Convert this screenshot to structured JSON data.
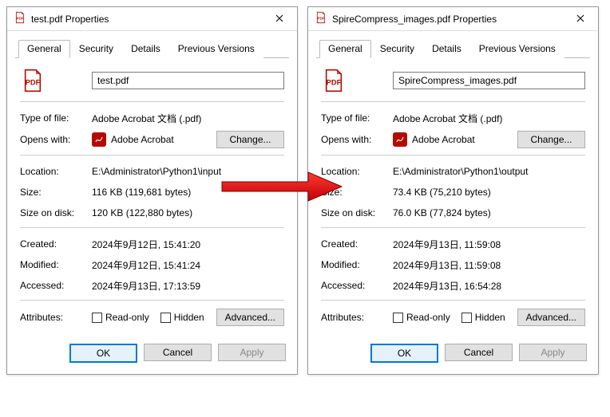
{
  "dialogs": [
    {
      "title": "test.pdf Properties",
      "filename": "test.pdf",
      "type_of_file": "Adobe Acrobat 文档 (.pdf)",
      "opens_with": "Adobe Acrobat",
      "location": "E:\\Administrator\\Python1\\input",
      "size": "116 KB (119,681 bytes)",
      "size_on_disk": "120 KB (122,880 bytes)",
      "created": "2024年9月12日, 15:41:20",
      "modified": "2024年9月12日, 15:41:24",
      "accessed": "2024年9月13日, 17:13:59"
    },
    {
      "title": "SpireCompress_images.pdf Properties",
      "filename": "SpireCompress_images.pdf",
      "type_of_file": "Adobe Acrobat 文档 (.pdf)",
      "opens_with": "Adobe Acrobat",
      "location": "E:\\Administrator\\Python1\\output",
      "size": "73.4 KB (75,210 bytes)",
      "size_on_disk": "76.0 KB (77,824 bytes)",
      "created": "2024年9月13日, 11:59:08",
      "modified": "2024年9月13日, 11:59:08",
      "accessed": "2024年9月13日, 16:54:28"
    }
  ],
  "tabs": {
    "general": "General",
    "security": "Security",
    "details": "Details",
    "previous": "Previous Versions"
  },
  "labels": {
    "type_of_file": "Type of file:",
    "opens_with": "Opens with:",
    "location": "Location:",
    "size": "Size:",
    "size_on_disk": "Size on disk:",
    "created": "Created:",
    "modified": "Modified:",
    "accessed": "Accessed:",
    "attributes": "Attributes:"
  },
  "buttons": {
    "change": "Change...",
    "advanced": "Advanced...",
    "ok": "OK",
    "cancel": "Cancel",
    "apply": "Apply"
  },
  "checkboxes": {
    "readonly": "Read-only",
    "hidden": "Hidden"
  }
}
